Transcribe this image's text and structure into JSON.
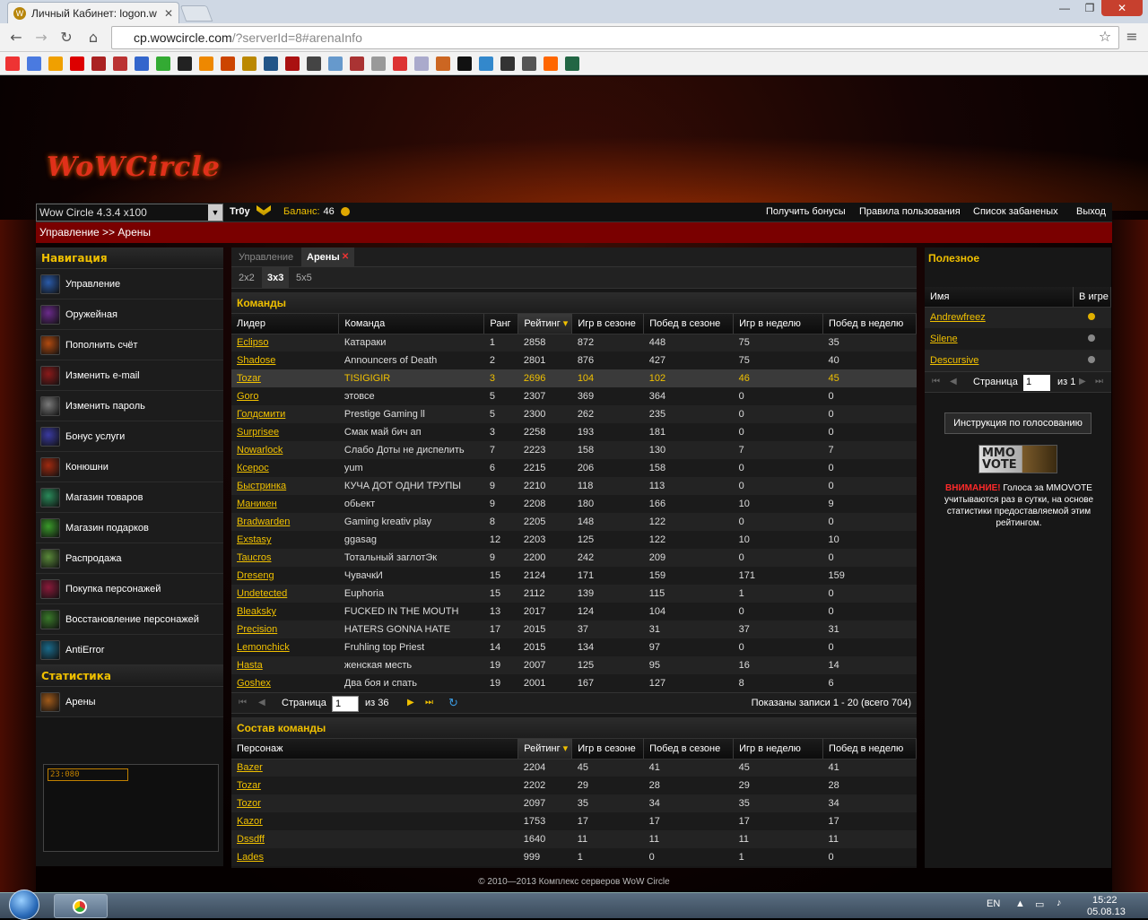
{
  "browser": {
    "tab_title": "Личный Кабинет: logon.w",
    "tab_close": "✕",
    "url_host": "cp.wowcircle.com",
    "url_path": "/?serverId=8#arenaInfo",
    "win_min": "—",
    "win_max": "❐",
    "win_close": "✕"
  },
  "header": {
    "logo": "WoWCircle",
    "server_select": "Wow Circle 4.3.4 x100",
    "username": "Tr0y",
    "balance_label": "Баланс:",
    "balance_value": "46",
    "links": {
      "bonuses": "Получить бонусы",
      "rules": "Правила пользования",
      "banned": "Список забаненых",
      "logout": "Выход"
    },
    "breadcrumb": "Управление >> Арены"
  },
  "leftnav": {
    "nav_title": "Навигация",
    "items": [
      {
        "label": "Управление",
        "icon": "dragon-icon",
        "color": "#2a5aa8"
      },
      {
        "label": "Оружейная",
        "icon": "weapons-icon",
        "color": "#6a2a8a"
      },
      {
        "label": "Пополнить счёт",
        "icon": "coins-icon",
        "color": "#b04a10"
      },
      {
        "label": "Изменить e-mail",
        "icon": "mail-icon",
        "color": "#8a1a1a"
      },
      {
        "label": "Изменить пароль",
        "icon": "key-icon",
        "color": "#7a7a7a"
      },
      {
        "label": "Бонус услуги",
        "icon": "magic-icon",
        "color": "#3a3aa0"
      },
      {
        "label": "Конюшни",
        "icon": "mount-icon",
        "color": "#a02a10"
      },
      {
        "label": "Магазин товаров",
        "icon": "shop-icon",
        "color": "#2a8a5a"
      },
      {
        "label": "Магазин подарков",
        "icon": "gift-icon",
        "color": "#3a9a2a"
      },
      {
        "label": "Распродажа",
        "icon": "sale-icon",
        "color": "#5a8a3a"
      },
      {
        "label": "Покупка персонажей",
        "icon": "buy-character-icon",
        "color": "#8a1a3a"
      },
      {
        "label": "Восстановление персонажей",
        "icon": "restore-character-icon",
        "color": "#3a7a2a"
      },
      {
        "label": "AntiError",
        "icon": "antierror-icon",
        "color": "#1a6a8a"
      }
    ],
    "stats_title": "Статистика",
    "stats_items": [
      {
        "label": "Арены",
        "icon": "arena-icon",
        "color": "#a05a1a"
      }
    ],
    "promo_tag": "23:080"
  },
  "center": {
    "tabs": [
      "Управление",
      "Арены"
    ],
    "active_tab_close": "✕",
    "subtabs": [
      "2x2",
      "3x3",
      "5x5"
    ],
    "teams_title": "Команды",
    "teams_columns": [
      "Лидер",
      "Команда",
      "Ранг",
      "Рейтинг",
      "Игр в сезоне",
      "Побед в сезоне",
      "Игр в неделю",
      "Побед в неделю"
    ],
    "teams": [
      [
        "Eclipso",
        "Катараки",
        "1",
        "2858",
        "872",
        "448",
        "75",
        "35"
      ],
      [
        "Shadose",
        "Announcers of Death",
        "2",
        "2801",
        "876",
        "427",
        "75",
        "40"
      ],
      [
        "Tozar",
        "TISIGIGIR",
        "3",
        "2696",
        "104",
        "102",
        "46",
        "45"
      ],
      [
        "Goro",
        "этовсе",
        "5",
        "2307",
        "369",
        "364",
        "0",
        "0"
      ],
      [
        "Голдсмити",
        "Prestige Gaming ll",
        "5",
        "2300",
        "262",
        "235",
        "0",
        "0"
      ],
      [
        "Surprisee",
        "Смак май бич ап",
        "3",
        "2258",
        "193",
        "181",
        "0",
        "0"
      ],
      [
        "Nowarlock",
        "Слабо Доты не диспелить",
        "7",
        "2223",
        "158",
        "130",
        "7",
        "7"
      ],
      [
        "Ксерос",
        "yum",
        "6",
        "2215",
        "206",
        "158",
        "0",
        "0"
      ],
      [
        "Быстринка",
        "КУЧА ДОТ ОДНИ ТРУПЫ",
        "9",
        "2210",
        "118",
        "113",
        "0",
        "0"
      ],
      [
        "Маникен",
        "обьект",
        "9",
        "2208",
        "180",
        "166",
        "10",
        "9"
      ],
      [
        "Bradwarden",
        "Gaming kreativ play",
        "8",
        "2205",
        "148",
        "122",
        "0",
        "0"
      ],
      [
        "Exstasy",
        "ggasag",
        "12",
        "2203",
        "125",
        "122",
        "10",
        "10"
      ],
      [
        "Taucros",
        "Тотальный заглотЭк",
        "9",
        "2200",
        "242",
        "209",
        "0",
        "0"
      ],
      [
        "Dreseng",
        "ЧувачкИ",
        "15",
        "2124",
        "171",
        "159",
        "171",
        "159"
      ],
      [
        "Undetected",
        "Euphoria",
        "15",
        "2112",
        "139",
        "115",
        "1",
        "0"
      ],
      [
        "Bleaksky",
        "FUCKED IN THE MOUTH",
        "13",
        "2017",
        "124",
        "104",
        "0",
        "0"
      ],
      [
        "Precision",
        "HATERS GONNA HATE",
        "17",
        "2015",
        "37",
        "31",
        "37",
        "31"
      ],
      [
        "Lemonchick",
        "Fruhling top Priest",
        "14",
        "2015",
        "134",
        "97",
        "0",
        "0"
      ],
      [
        "Hasta",
        "женская месть",
        "19",
        "2007",
        "125",
        "95",
        "16",
        "14"
      ],
      [
        "Goshex",
        "Два боя и спать",
        "19",
        "2001",
        "167",
        "127",
        "8",
        "6"
      ]
    ],
    "highlight_row": 2,
    "pager": {
      "page_label": "Страница",
      "page_value": "1",
      "of_label": "из 36",
      "records": "Показаны записи 1 - 20 (всего 704)"
    },
    "roster_title": "Состав команды",
    "roster_columns": [
      "Персонаж",
      "Рейтинг",
      "Игр в сезоне",
      "Побед в сезоне",
      "Игр в неделю",
      "Побед в неделю"
    ],
    "roster": [
      [
        "Bazer",
        "2204",
        "45",
        "41",
        "45",
        "41"
      ],
      [
        "Tozar",
        "2202",
        "29",
        "28",
        "29",
        "28"
      ],
      [
        "Tozor",
        "2097",
        "35",
        "34",
        "35",
        "34"
      ],
      [
        "Kazor",
        "1753",
        "17",
        "17",
        "17",
        "17"
      ],
      [
        "Dssdff",
        "1640",
        "11",
        "11",
        "11",
        "11"
      ],
      [
        "Lades",
        "999",
        "1",
        "0",
        "1",
        "0"
      ]
    ]
  },
  "right": {
    "title": "Полезное",
    "columns": [
      "Имя",
      "В игре"
    ],
    "players": [
      {
        "name": "Andrewfreez",
        "status_color": "#e0b000"
      },
      {
        "name": "Silene",
        "status_color": "#888888"
      },
      {
        "name": "Descursive",
        "status_color": "#888888"
      }
    ],
    "pager_label": "Страница",
    "pager_value": "1",
    "pager_of": "из 1",
    "guide_button": "Инструкция по голосованию",
    "mmo_line1": "MMO",
    "mmo_line2": "VOTE",
    "warn_word": "ВНИМАНИЕ!",
    "vote_text": "Голоса за MMOVOTE учитываются раз в сутки, на основе статистики предоставляемой этим рейтингом."
  },
  "footer": "© 2010—2013 Комплекс серверов WoW Circle",
  "taskbar": {
    "lang": "EN",
    "time": "15:22",
    "date": "05.08.13"
  }
}
